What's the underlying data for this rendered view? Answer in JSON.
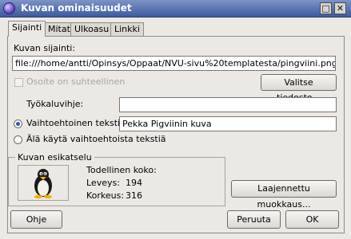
{
  "window": {
    "title": "Kuvan ominaisuudet",
    "minimize_glyph": "□",
    "close_glyph": "✕"
  },
  "tabs": [
    {
      "label": "Sijainti",
      "active": true
    },
    {
      "label": "Mitat",
      "active": false
    },
    {
      "label": "Ulkoasu",
      "active": false
    },
    {
      "label": "Linkki",
      "active": false
    }
  ],
  "location": {
    "label": "Kuvan sijainti:",
    "value": "file:///home/antti/Opinsys/Oppaat/NVU-sivu%20templatesta/pingviini.png",
    "relative_label": "Osoite on suhteellinen",
    "choose_button": "Valitse tiedosto..."
  },
  "tooltip": {
    "label": "Työkaluvihje:",
    "value": ""
  },
  "alt_text": {
    "label": "Vaihtoehtoinen teksti:",
    "value": "Pekka Pigviinin kuva",
    "selected": true
  },
  "no_alt": {
    "label": "Älä käytä vaihtoehtoista tekstiä",
    "selected": false
  },
  "preview": {
    "group_title": "Kuvan esikatselu",
    "actual_size_label": "Todellinen koko:",
    "width_label": "Leveys:",
    "width_value": "194",
    "height_label": "Korkeus:",
    "height_value": "316",
    "image": "penguin-icon"
  },
  "advanced_button": "Laajennettu muokkaus...",
  "footer": {
    "help": "Ohje",
    "cancel": "Peruuta",
    "ok": "OK"
  }
}
